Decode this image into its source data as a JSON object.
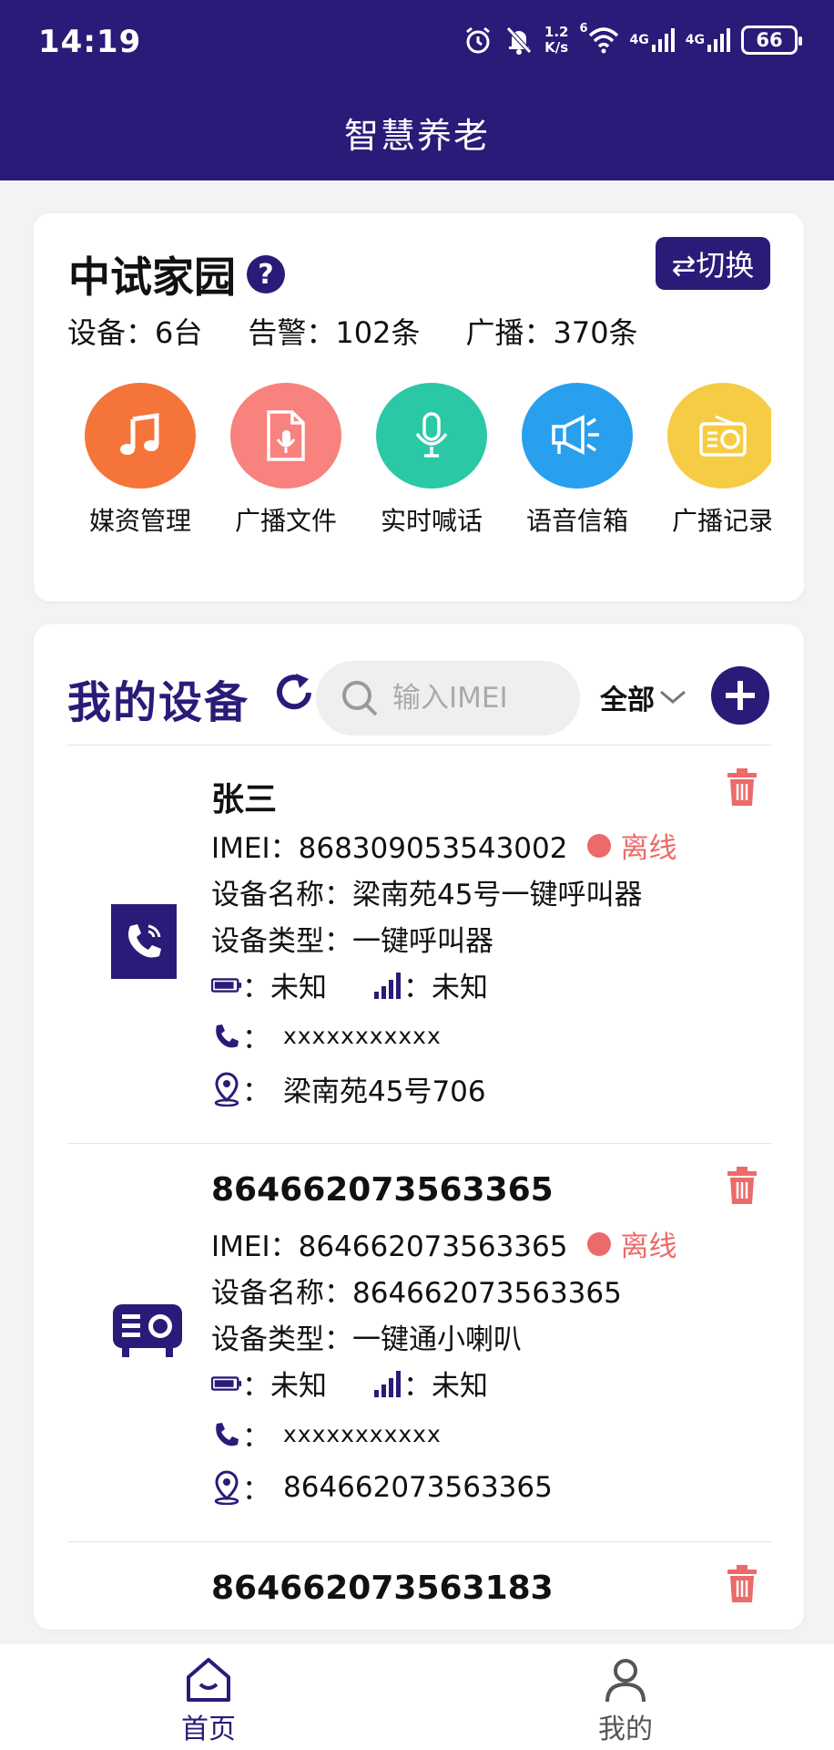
{
  "status_bar": {
    "time": "14:19",
    "speed_top": "1.2",
    "speed_bottom": "K/s",
    "wifi_label": "6",
    "net1": "4G",
    "net2": "4G",
    "battery": "66"
  },
  "header": {
    "title": "智慧养老"
  },
  "community": {
    "name": "中试家园",
    "help_symbol": "?",
    "switch_label": "⇄切换",
    "stats": [
      {
        "label": "设备：6台"
      },
      {
        "label": "告警：102条"
      },
      {
        "label": "广播：370条"
      }
    ]
  },
  "quick_actions": [
    {
      "label": "媒资管理",
      "color": "#f4743a",
      "icon": "music-note-icon"
    },
    {
      "label": "广播文件",
      "color": "#f8827e",
      "icon": "audio-file-icon"
    },
    {
      "label": "实时喊话",
      "color": "#2ac8a4",
      "icon": "microphone-icon"
    },
    {
      "label": "语音信箱",
      "color": "#29a0ee",
      "icon": "megaphone-icon"
    },
    {
      "label": "广播记录",
      "color": "#f6cc45",
      "icon": "radio-icon"
    }
  ],
  "devices_section": {
    "title": "我的设备",
    "search_placeholder": "输入IMEI",
    "filter_label": "全部"
  },
  "devices": [
    {
      "name": "张三",
      "imei": "IMEI：868309053543002",
      "status": "离线",
      "device_name": "设备名称：梁南苑45号一键呼叫器",
      "device_type": "设备类型：一键呼叫器",
      "battery_value": "未知",
      "signal_value": "未知",
      "phone": "xxxxxxxxxxx",
      "location": "梁南苑45号706",
      "icon": "phone-call-icon"
    },
    {
      "name": "864662073563365",
      "imei": "IMEI：864662073563365",
      "status": "离线",
      "device_name": "设备名称：864662073563365",
      "device_type": "设备类型：一键通小喇叭",
      "battery_value": "未知",
      "signal_value": "未知",
      "phone": "xxxxxxxxxxx",
      "location": "864662073563365",
      "icon": "speaker-device-icon"
    },
    {
      "name": "864662073563183"
    }
  ],
  "colon": "：",
  "bottom_nav": [
    {
      "label": "首页",
      "active": true
    },
    {
      "label": "我的",
      "active": false
    }
  ],
  "colors": {
    "primary": "#2a1b78",
    "offline": "#ec6a6a",
    "delete": "#ec6a6a"
  }
}
